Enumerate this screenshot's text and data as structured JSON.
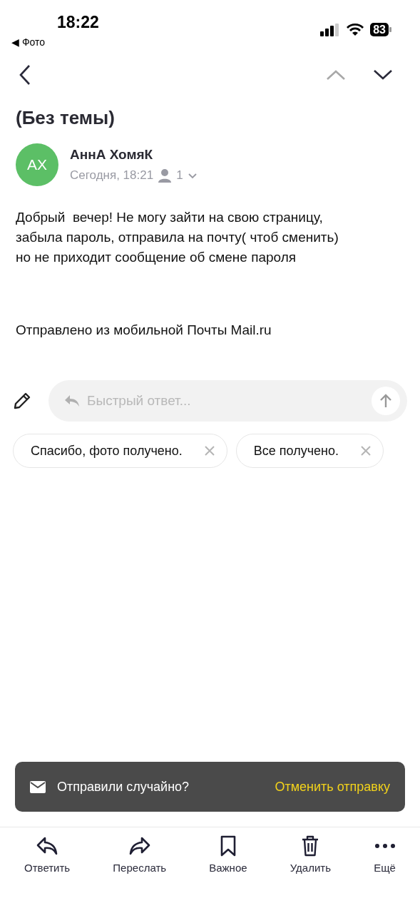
{
  "status_bar": {
    "time": "18:22",
    "back_app": "◀ Фото",
    "battery": "83"
  },
  "nav": {
    "prev_disabled": true,
    "next_disabled": false
  },
  "subject": "(Без темы)",
  "sender": {
    "initials": "АХ",
    "color": "#5cbf66",
    "name": "АннА ХомяК",
    "date": "Сегодня, 18:21",
    "recipients": "1"
  },
  "body": "Добрый  вечер! Не могу зайти на свою страницу,\nзабыла пароль, отправила на почту( чтоб сменить)\nно не приходит сообщение об смене пароля",
  "signature": "Отправлено из мобильной Почты Mail.ru",
  "quick_reply": {
    "placeholder": "Быстрый ответ..."
  },
  "suggestions": [
    {
      "label": "Спасибо, фото получено."
    },
    {
      "label": "Все получено."
    }
  ],
  "snackbar": {
    "message": "Отправили случайно?",
    "action": "Отменить отправку"
  },
  "toolbar": [
    {
      "kind": "reply",
      "label": "Ответить"
    },
    {
      "kind": "forward",
      "label": "Переслать"
    },
    {
      "kind": "bookmark",
      "label": "Важное"
    },
    {
      "kind": "delete",
      "label": "Удалить"
    },
    {
      "kind": "more",
      "label": "Ещё"
    }
  ]
}
